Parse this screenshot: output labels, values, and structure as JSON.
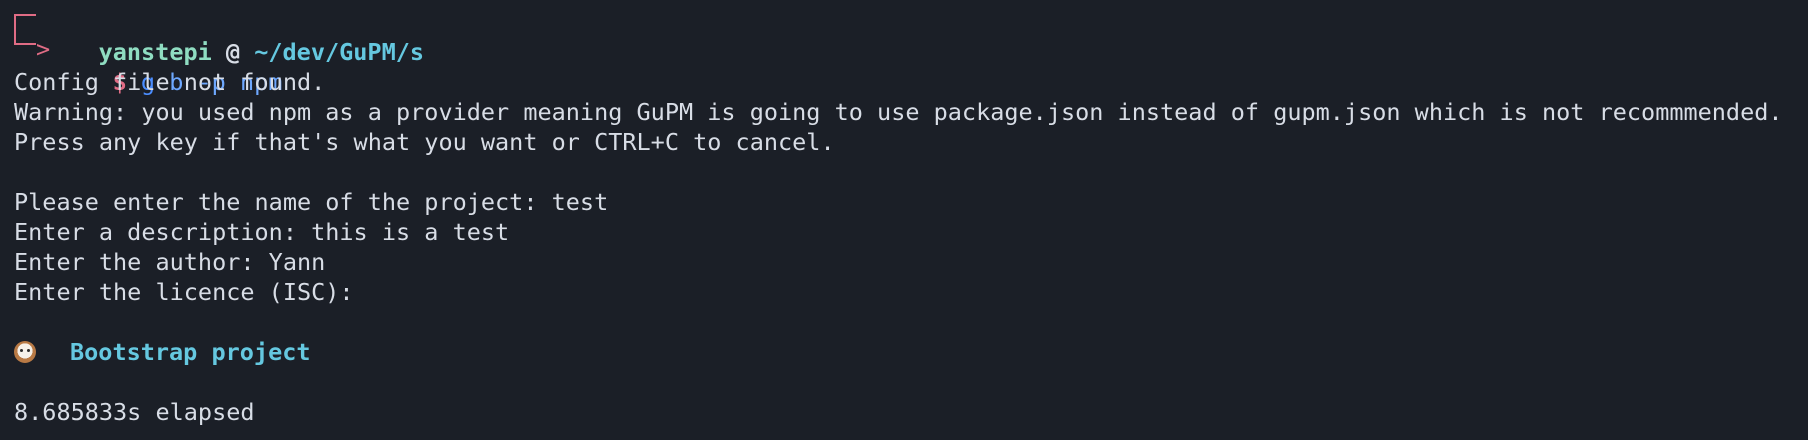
{
  "prompt": {
    "user": "yanstepi",
    "at": " @ ",
    "path": "~/dev/GuPM/s",
    "symbol": "$",
    "command_prefix": "g",
    "command_rest": " b -p npm"
  },
  "output": {
    "config_not_found": "Config file not found.",
    "warning": "Warning: you used npm as a provider meaning GuPM is going to use package.json instead of gupm.json which is not recommmended.",
    "press_any_key": "Press any key if that's what you want or CTRL+C to cancel.",
    "project_name": "Please enter the name of the project: test",
    "description": "Enter a description: this is a test",
    "author": "Enter the author: Yann",
    "licence": "Enter the licence (ISC):",
    "bootstrap_title": "Bootstrap project",
    "elapsed": "8.685833s elapsed"
  },
  "icons": {
    "prompt_corner": "box-corner-icon",
    "prompt_arrow": "arrow-right-icon",
    "bootstrap": "dog-emoji-icon"
  }
}
